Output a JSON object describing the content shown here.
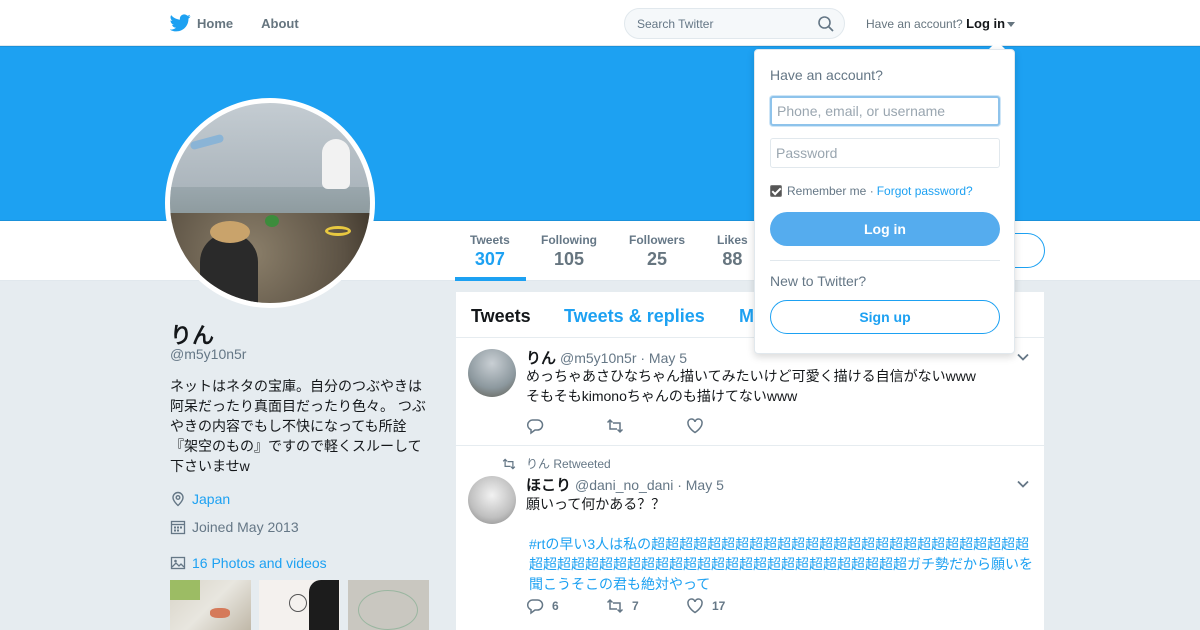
{
  "nav": {
    "home_label": "Home",
    "about_label": "About",
    "search_placeholder": "Search Twitter",
    "have_account_text": "Have an account?",
    "login_label": "Log in"
  },
  "profile_stats": [
    {
      "label": "Tweets",
      "value": "307"
    },
    {
      "label": "Following",
      "value": "105"
    },
    {
      "label": "Followers",
      "value": "25"
    },
    {
      "label": "Likes",
      "value": "88"
    }
  ],
  "profile": {
    "name": "りん",
    "handle": "@m5y10n5r",
    "bio": "ネットはネタの宝庫。自分のつぶやきは阿呆だったり真面目だったり色々。 つぶやきの内容でもし不快になっても所詮『架空のもの』ですので軽くスルーして下さいませw",
    "location": "Japan",
    "joined": "Joined May 2013",
    "photos_link": "16 Photos and videos"
  },
  "timeline": {
    "tabs": [
      "Tweets",
      "Tweets & replies",
      "M"
    ],
    "tweets": [
      {
        "name": "りん",
        "handle": "@m5y10n5r",
        "date": "· May 5",
        "text_line1": "めっちゃあさひなちゃん描いてみたいけど可愛く描ける自信がないwww",
        "text_line2": "そもそもkimonoちゃんのも描けてないwww",
        "replies": "",
        "retweets": "",
        "likes": ""
      },
      {
        "retweet_note": "りん Retweeted",
        "name": "ほこり",
        "handle": "@dani_no_dani",
        "date": "· May 5",
        "text_line1": "願いって何かある？？",
        "hashtag": "#rt",
        "hash_rest": "の早い3人は私の超超超超超超超超超超超超超超超超超超超超超超超超超超超超超超超超超超超超超超超超超超超超超超超超超超超超超超ガチ勢だから願いを聞こうそこの君も絶対やって",
        "replies": "6",
        "retweets": "7",
        "likes": "17"
      }
    ]
  },
  "login_dropdown": {
    "title": "Have an account?",
    "username_placeholder": "Phone, email, or username",
    "password_placeholder": "Password",
    "remember_label": "Remember me ·",
    "forgot_label": "Forgot password?",
    "login_button": "Log in",
    "new_to_twitter": "New to Twitter?",
    "signup_button": "Sign up"
  },
  "colors": {
    "brand_blue": "#1da1f2",
    "button_blue": "#55acee",
    "muted_text": "#657786",
    "page_bg": "#e6ecf0"
  },
  "icons": [
    "twitter-bird-icon",
    "search-icon",
    "location-icon",
    "calendar-icon",
    "photo-icon",
    "reply-icon",
    "retweet-icon",
    "like-icon",
    "chevron-down-icon"
  ]
}
